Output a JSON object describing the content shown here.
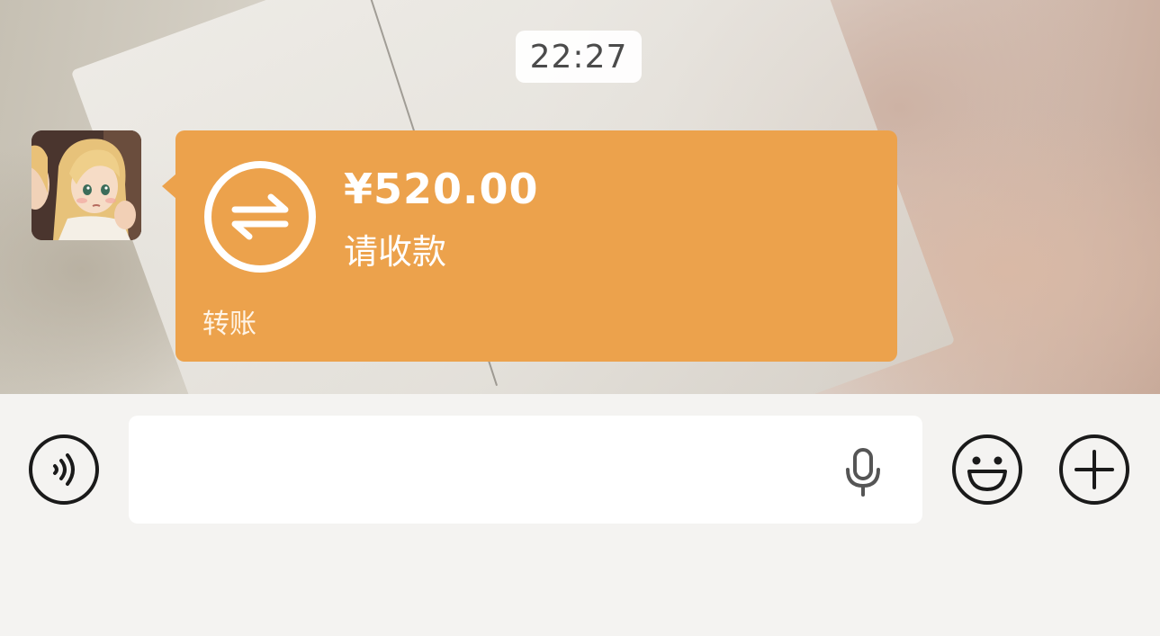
{
  "chat": {
    "timestamp": "22:27",
    "message": {
      "type": "transfer",
      "amount": "¥520.00",
      "subtitle": "请收款",
      "footer_label": "转账",
      "bubble_color": "#eca24c",
      "icon": "transfer-arrows-icon"
    },
    "sender_avatar": "cartoon-girl-avatar"
  },
  "input_bar": {
    "left_button_icon": "voice-mode-icon",
    "input_value": "",
    "input_placeholder": "",
    "mic_icon": "microphone-icon",
    "emoji_icon": "emoji-smile-icon",
    "plus_icon": "plus-circle-icon"
  }
}
